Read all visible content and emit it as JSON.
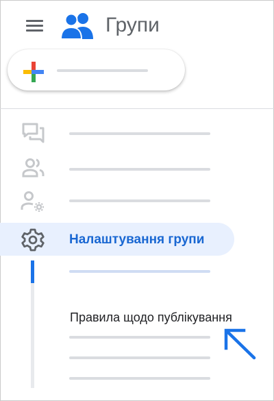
{
  "header": {
    "menu_icon": "menu-icon",
    "logo_icon": "groups-logo-icon",
    "logo_color": "#1a73e8",
    "title": "Групи"
  },
  "create_button": {
    "icon": "plus-icon",
    "label_placeholder": ""
  },
  "nav": {
    "items": [
      {
        "icon": "conversations-icon"
      },
      {
        "icon": "members-icon"
      },
      {
        "icon": "member-settings-icon"
      },
      {
        "icon": "gear-icon",
        "label": "Налаштування групи",
        "active": true
      }
    ],
    "settings_subitems": [
      {
        "active": true
      },
      {
        "label": "Правила щодо публікування",
        "highlighted": true
      },
      {},
      {}
    ]
  },
  "annotation": {
    "icon": "arrow-pointer-icon",
    "color": "#1a73e8"
  },
  "colors": {
    "accent": "#1a73e8",
    "active_background": "#e8f0fe",
    "active_text": "#1967d2",
    "placeholder_gray": "#dadce0",
    "icon_gray": "#c6c8cb"
  }
}
